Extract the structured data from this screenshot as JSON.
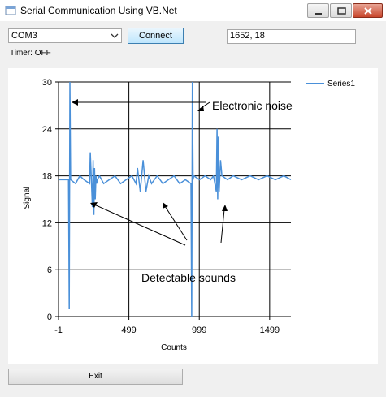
{
  "window": {
    "title": "Serial Communication Using VB.Net"
  },
  "controls": {
    "port_value": "COM3",
    "connect_label": "Connect",
    "coords_value": "1652, 18",
    "timer_text": "Timer: OFF",
    "exit_label": "Exit"
  },
  "colors": {
    "series": "#4a90d9",
    "accent_close": "#c8462c"
  },
  "annotations": {
    "noise_label": "Electronic noise",
    "sounds_label": "Detectable sounds"
  },
  "chart_data": {
    "type": "line",
    "xlabel": "Counts",
    "ylabel": "Signal",
    "xlim": [
      -1,
      1650
    ],
    "ylim": [
      0,
      30
    ],
    "x_ticks": [
      "-1",
      "499",
      "999",
      "1499"
    ],
    "y_ticks": [
      "0",
      "6",
      "12",
      "18",
      "24",
      "30"
    ],
    "legend_position": "top-right",
    "grid": true,
    "series": [
      {
        "name": "Series1",
        "x": [
          -1,
          30,
          70,
          75,
          80,
          85,
          120,
          150,
          180,
          220,
          225,
          240,
          245,
          250,
          255,
          260,
          265,
          270,
          275,
          290,
          320,
          360,
          400,
          440,
          480,
          520,
          550,
          560,
          580,
          600,
          620,
          640,
          660,
          700,
          740,
          780,
          820,
          860,
          900,
          940,
          945,
          950,
          955,
          960,
          1000,
          1040,
          1080,
          1100,
          1120,
          1125,
          1130,
          1135,
          1140,
          1150,
          1160,
          1200,
          1240,
          1300,
          1360,
          1420,
          1480,
          1540,
          1600,
          1650
        ],
        "y": [
          17.5,
          17.5,
          17.5,
          1,
          30,
          17.5,
          17,
          18,
          17.5,
          17,
          21,
          14,
          20,
          13,
          19,
          15,
          18,
          17,
          17.5,
          18,
          17,
          17.5,
          18,
          17,
          17.5,
          18,
          17,
          19,
          16,
          20,
          16,
          18,
          17,
          18,
          17,
          17.5,
          18,
          17,
          17.5,
          17,
          0,
          30,
          17.5,
          18,
          17.5,
          18,
          17.5,
          18,
          16,
          24,
          15,
          23,
          16,
          20,
          18,
          17.5,
          18,
          17.5,
          18,
          17.5,
          18,
          17.5,
          18,
          17.5
        ]
      }
    ]
  }
}
